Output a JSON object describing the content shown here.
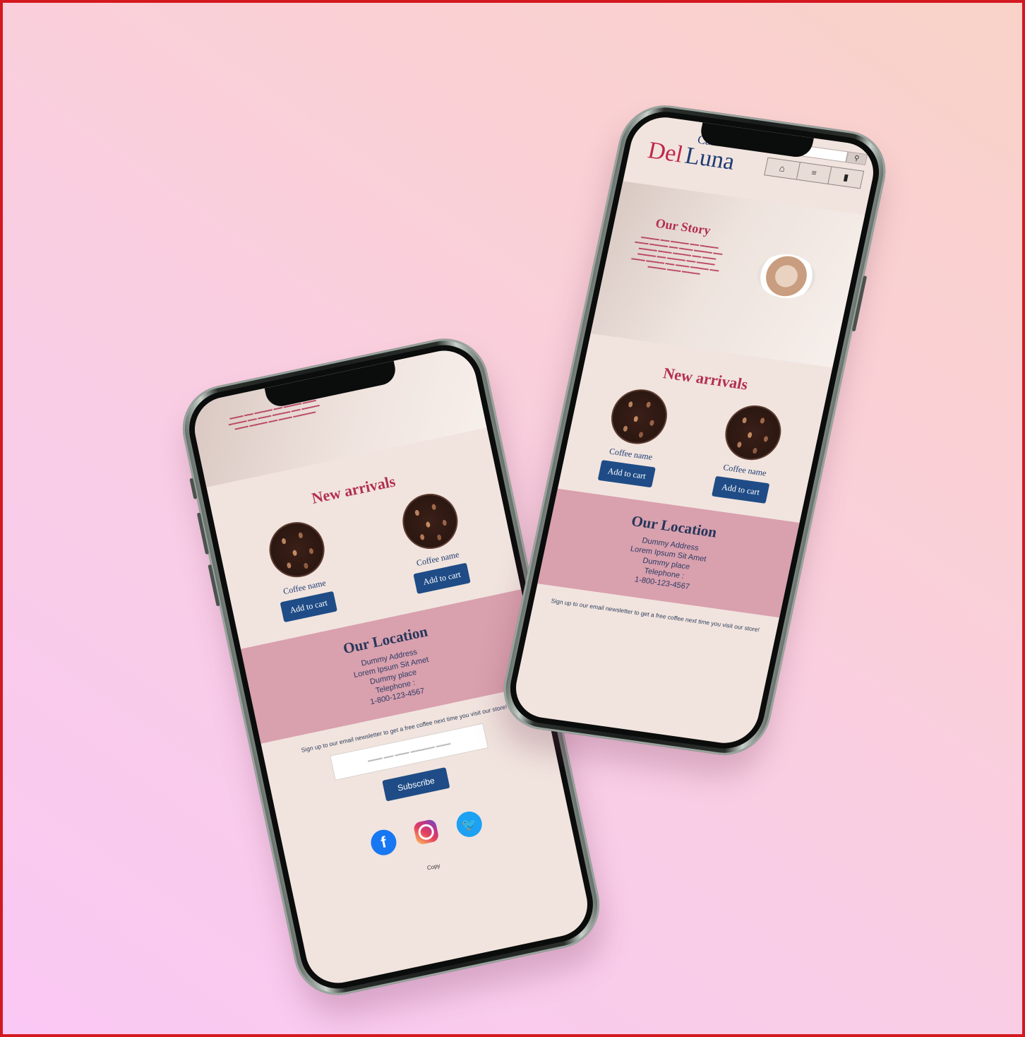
{
  "colors": {
    "frame_border": "#d4181f",
    "brand_red": "#c0284a",
    "brand_navy": "#1e3c73",
    "button_blue": "#1f4c86",
    "location_pink": "#d9a0ad",
    "screen_bg": "#f1e4de"
  },
  "site": {
    "brand": {
      "cafe": "Cafe",
      "del": "Del",
      "luna": "Luna"
    },
    "nav_icons": [
      "home-icon",
      "menu-icon",
      "cart-icon"
    ],
    "search_icon": "search-icon",
    "story": {
      "title": "Our Story"
    },
    "new_arrivals": {
      "title": "New arrivals",
      "products": [
        {
          "name": "Coffee name",
          "button": "Add to cart"
        },
        {
          "name": "Coffee name",
          "button": "Add to cart"
        }
      ]
    },
    "location": {
      "title": "Our Location",
      "line1": "Dummy Address",
      "line2": "Lorem Ipsum Sit Amet",
      "line3": "Dummy place",
      "line4": "Telephone :",
      "line5": "1-800-123-4567"
    },
    "newsletter": {
      "text": "Sign up to our email newsletter to get a free coffee next time you visit our store!",
      "subscribe": "Subscribe"
    },
    "socials": [
      "facebook-icon",
      "instagram-icon",
      "twitter-icon"
    ],
    "copyright": "Copy"
  }
}
